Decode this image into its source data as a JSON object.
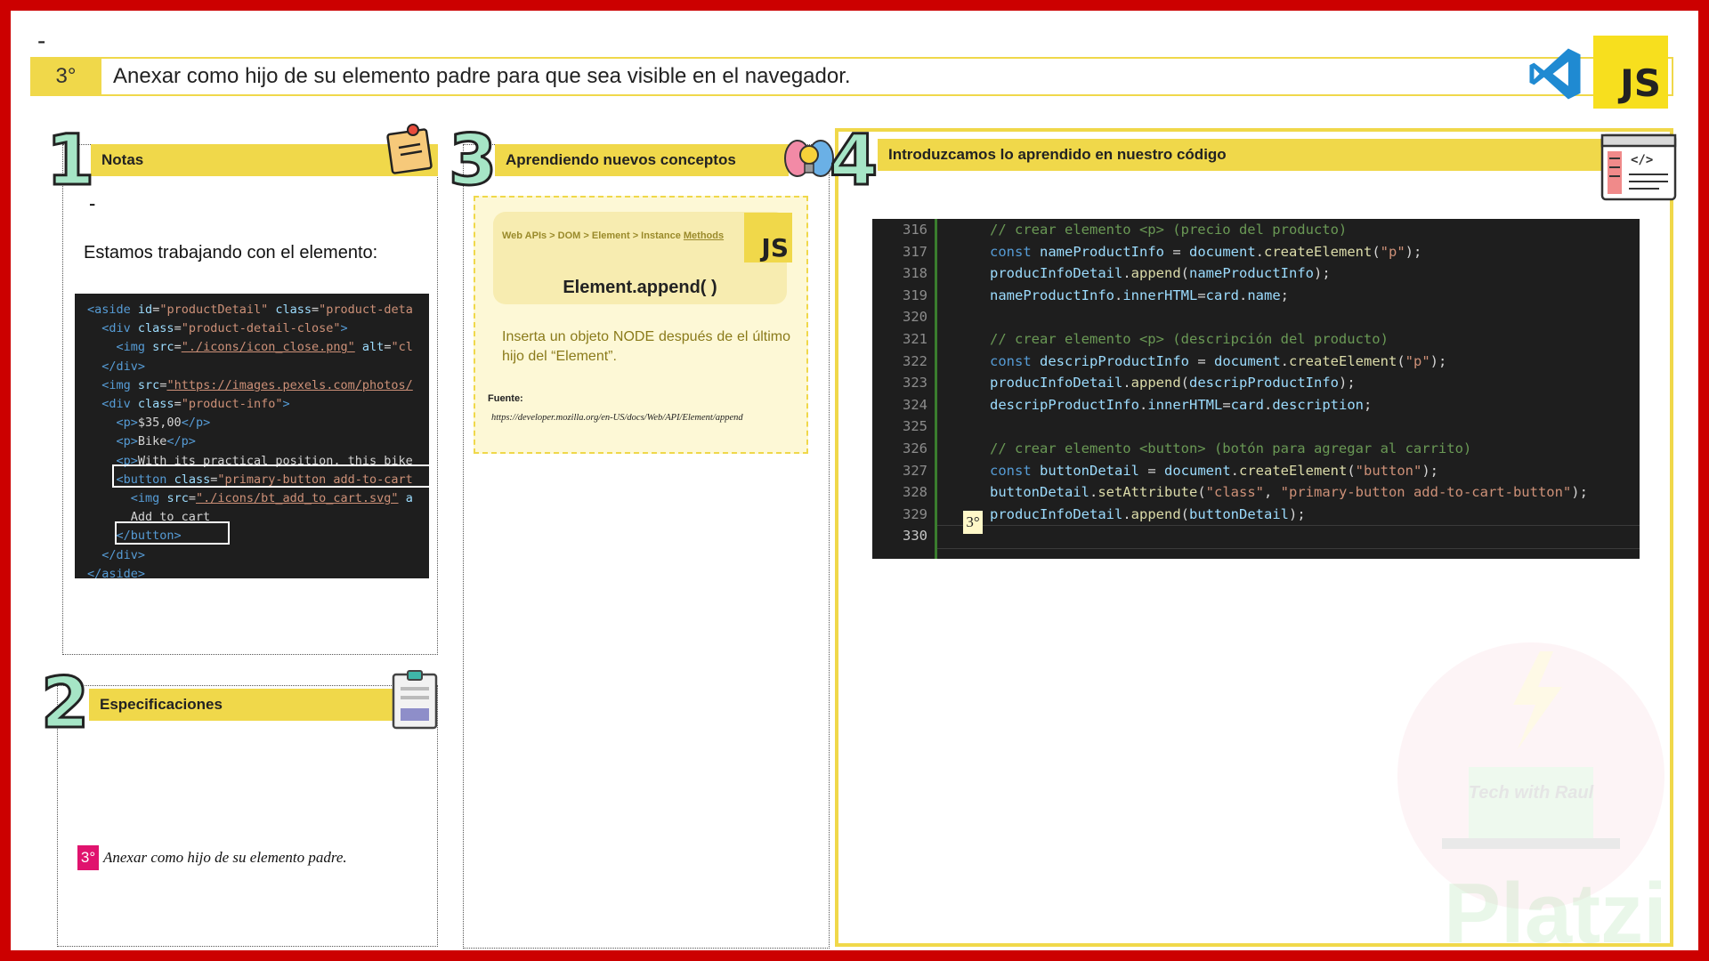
{
  "header": {
    "dash": "-",
    "step": "3°",
    "text": "Anexar como hijo de su elemento padre para que sea visible en el navegador.",
    "js_logo": "JS",
    "icons": [
      "vscode-icon",
      "javascript-icon"
    ]
  },
  "sections": {
    "notes": {
      "number": "1",
      "title": "Notas",
      "icon": "sticky-note-icon"
    },
    "specs": {
      "number": "2",
      "title": "Especificaciones",
      "icon": "clipboard-icon"
    },
    "concepts": {
      "number": "3",
      "title": "Aprendiendo nuevos conceptos",
      "icon": "brain-bulb-icon"
    },
    "code": {
      "number": "4",
      "title": "Introduzcamos lo aprendido en nuestro código",
      "icon": "code-window-icon"
    }
  },
  "notes": {
    "dash": "-",
    "text": "Estamos trabajando con el elemento:",
    "snippet": [
      "<aside id=\"productDetail\" class=\"product-deta",
      "  <div class=\"product-detail-close\">",
      "    <img src=\"./icons/icon_close.png\" alt=\"cl",
      "  </div>",
      "  <img src=\"https://images.pexels.com/photos/",
      "  <div class=\"product-info\">",
      "    <p>$35,00</p>",
      "    <p>Bike</p>",
      "    <p>With its practical position, this bike",
      "    <button class=\"primary-button add-to-cart",
      "      <img src=\"./icons/bt_add_to_cart.svg\" a",
      "      Add to cart",
      "    </button>",
      "  </div>",
      "</aside>"
    ]
  },
  "specs": {
    "badge": "3°",
    "text": "Anexar como hijo de su elemento padre."
  },
  "concepts": {
    "breadcrumb_prefix": "Web APIs > DOM > Element > Instance ",
    "breadcrumb_link": "Methods",
    "js_badge": "JS",
    "title": "Element.append( )",
    "description": "Inserta un objeto NODE después de el último hijo del “Element”.",
    "source_label": "Fuente:",
    "source_url": "https://developer.mozilla.org/en-US/docs/Web/API/Element/append"
  },
  "code": {
    "badge": "3°",
    "lines": [
      {
        "n": "316",
        "t": "// crear elemento <p> (precio del producto)"
      },
      {
        "n": "317",
        "t": "const nameProductInfo = document.createElement(\"p\");"
      },
      {
        "n": "318",
        "t": "producInfoDetail.append(nameProductInfo);"
      },
      {
        "n": "319",
        "t": "nameProductInfo.innerHTML=card.name;"
      },
      {
        "n": "320",
        "t": ""
      },
      {
        "n": "321",
        "t": "// crear elemento <p> (descripción del producto)"
      },
      {
        "n": "322",
        "t": "const descripProductInfo = document.createElement(\"p\");"
      },
      {
        "n": "323",
        "t": "producInfoDetail.append(descripProductInfo);"
      },
      {
        "n": "324",
        "t": "descripProductInfo.innerHTML=card.description;"
      },
      {
        "n": "325",
        "t": ""
      },
      {
        "n": "326",
        "t": "// crear elemento <button> (botón para agregar al carrito)"
      },
      {
        "n": "327",
        "t": "const buttonDetail = document.createElement(\"button\");"
      },
      {
        "n": "328",
        "t": "buttonDetail.setAttribute(\"class\", \"primary-button add-to-cart-button\");"
      },
      {
        "n": "329",
        "t": "producInfoDetail.append(buttonDetail);"
      },
      {
        "n": "330",
        "t": ""
      }
    ]
  },
  "watermark": {
    "text": "Tech with Raul",
    "brand": "Platzi"
  }
}
